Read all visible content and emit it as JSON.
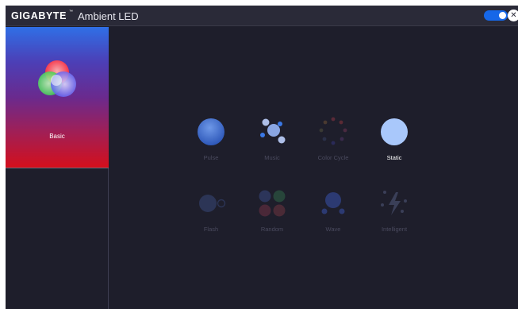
{
  "titlebar": {
    "brand": "GIGABYTE",
    "brand_tm": "™",
    "title": "Ambient LED",
    "power_toggle_on": true,
    "close_glyph": "✕"
  },
  "sidebar": {
    "items": [
      {
        "label": "Basic",
        "icon": "rgb-circles-icon",
        "selected": true
      }
    ]
  },
  "effects": {
    "pulse": {
      "label": "Pulse",
      "icon": "pulse-icon",
      "active": false
    },
    "music": {
      "label": "Music",
      "icon": "music-icon",
      "active": false
    },
    "color_cycle": {
      "label": "Color Cycle",
      "icon": "color-cycle-icon",
      "active": false
    },
    "static": {
      "label": "Static",
      "icon": "static-icon",
      "active": true
    },
    "flash": {
      "label": "Flash",
      "icon": "flash-icon",
      "active": false
    },
    "random": {
      "label": "Random",
      "icon": "random-icon",
      "active": false
    },
    "wave": {
      "label": "Wave",
      "icon": "wave-icon",
      "active": false
    },
    "intelligent": {
      "label": "Intelligent",
      "icon": "intelligent-icon",
      "active": false
    }
  },
  "colors": {
    "background": "#1e1e2b",
    "titlebar": "#2a2a38",
    "accent": "#1667e8",
    "active_effect": "#a9c8fb",
    "inactive_label": "#4a4a5e"
  }
}
